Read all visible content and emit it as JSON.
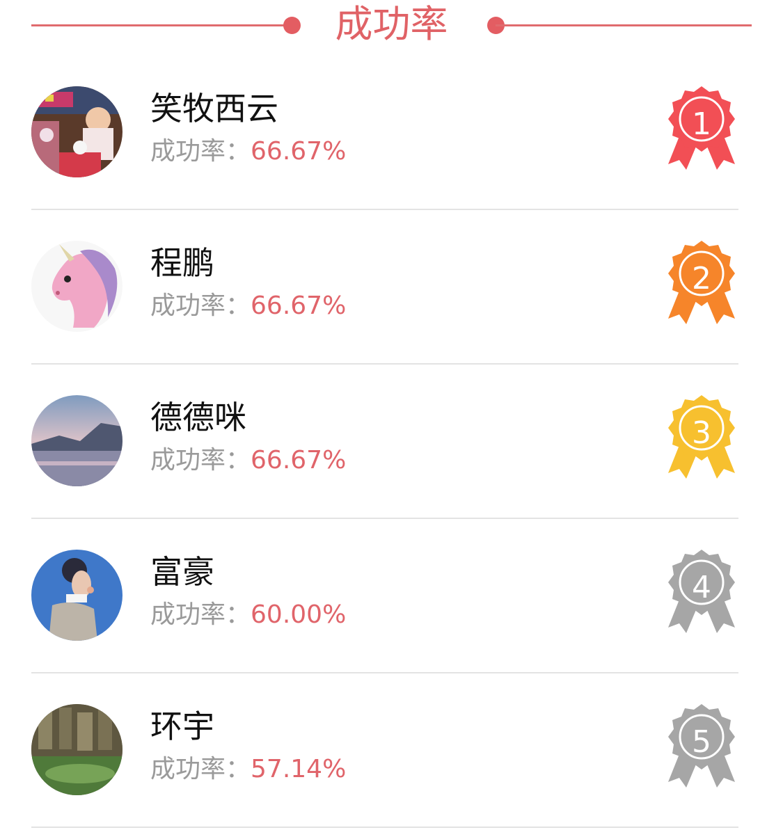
{
  "header": {
    "title": "成功率"
  },
  "rank_label": "成功率：",
  "entries": [
    {
      "rank": "1",
      "name": "笑牧西云",
      "rate": "66.67%",
      "medal_color": "#f24f55",
      "avatar": "child-photo"
    },
    {
      "rank": "2",
      "name": "程鹏",
      "rate": "66.67%",
      "medal_color": "#f6852a",
      "avatar": "unicorn-cartoon"
    },
    {
      "rank": "3",
      "name": "德德咪",
      "rate": "66.67%",
      "medal_color": "#f7c02f",
      "avatar": "lake-landscape"
    },
    {
      "rank": "4",
      "name": "富豪",
      "rate": "60.00%",
      "medal_color": "#a6a6a6",
      "avatar": "man-illustration"
    },
    {
      "rank": "5",
      "name": "环宇",
      "rate": "57.14%",
      "medal_color": "#a6a6a6",
      "avatar": "rock-waterfall"
    }
  ],
  "colors": {
    "accent": "#e06266",
    "label_gray": "#9a9a9a",
    "divider": "#e3e3e3"
  }
}
